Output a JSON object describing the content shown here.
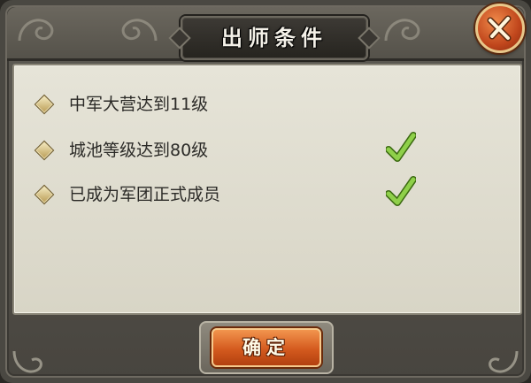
{
  "dialog": {
    "title": "出师条件",
    "close_icon": "close-x-icon"
  },
  "conditions": [
    {
      "text": "中军大营达到11级",
      "met": false
    },
    {
      "text": "城池等级达到80级",
      "met": true
    },
    {
      "text": "已成为军团正式成员",
      "met": true
    }
  ],
  "footer": {
    "confirm_label": "确定"
  },
  "colors": {
    "frame": "#4a4842",
    "panel": "#e2e0d4",
    "check_green": "#7cc43a",
    "button_orange": "#d45a1e"
  }
}
